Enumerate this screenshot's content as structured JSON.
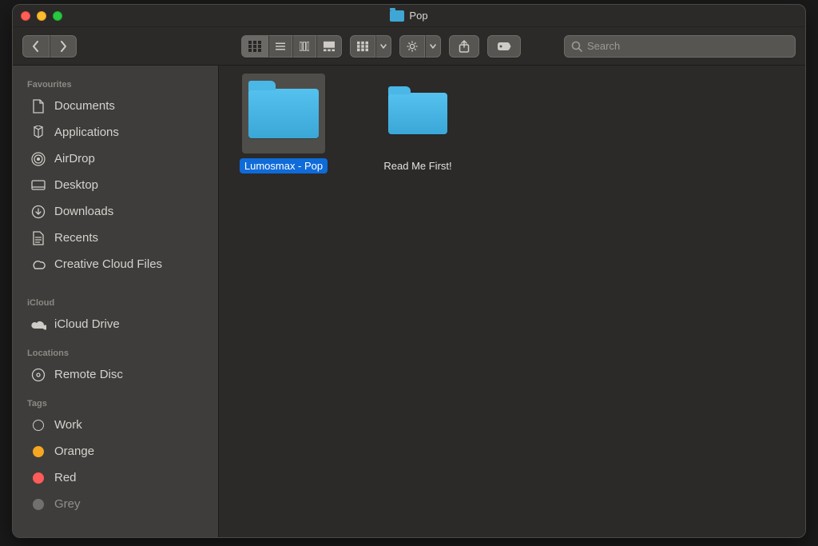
{
  "window": {
    "title": "Pop"
  },
  "search": {
    "placeholder": "Search"
  },
  "sidebar": {
    "sections": [
      {
        "header": "Favourites",
        "items": [
          {
            "label": "Documents"
          },
          {
            "label": "Applications"
          },
          {
            "label": "AirDrop"
          },
          {
            "label": "Desktop"
          },
          {
            "label": "Downloads"
          },
          {
            "label": "Recents"
          },
          {
            "label": "Creative Cloud Files"
          }
        ]
      },
      {
        "header": "iCloud",
        "items": [
          {
            "label": "iCloud Drive"
          }
        ]
      },
      {
        "header": "Locations",
        "items": [
          {
            "label": "Remote Disc"
          }
        ]
      },
      {
        "header": "Tags",
        "items": [
          {
            "label": "Work"
          },
          {
            "label": "Orange"
          },
          {
            "label": "Red"
          },
          {
            "label": "Grey"
          }
        ]
      }
    ]
  },
  "colors": {
    "tagWork": "transparent",
    "tagOrange": "#f5a623",
    "tagRed": "#ff5b59",
    "tagGrey": "#9c9a95"
  },
  "items": [
    {
      "name": "Lumosmax - Pop",
      "selected": true
    },
    {
      "name": "Read Me First!",
      "selected": false
    }
  ]
}
